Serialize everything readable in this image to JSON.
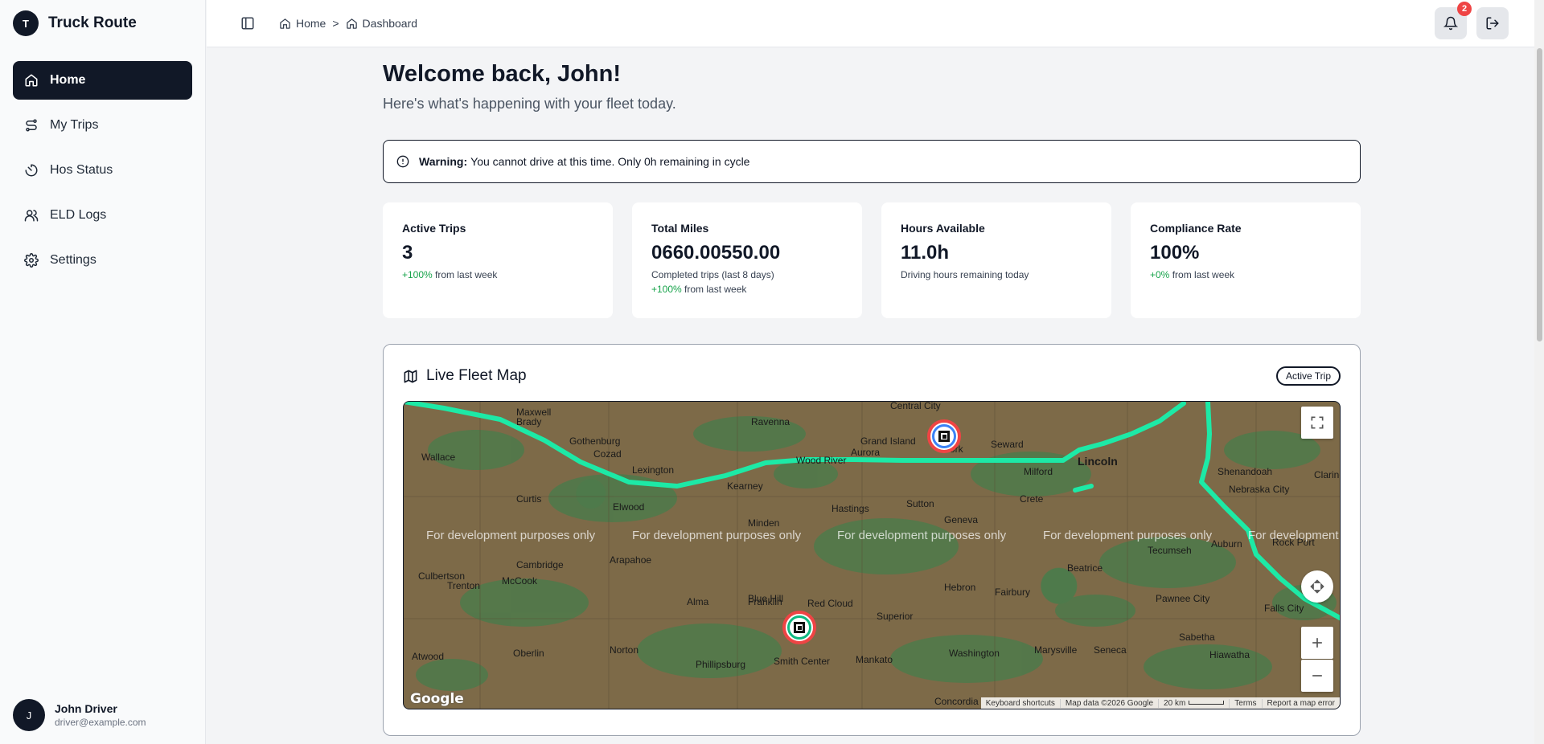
{
  "app": {
    "logo_letter": "T",
    "name": "Truck Route"
  },
  "sidebar": {
    "items": [
      {
        "label": "Home",
        "icon": "home-icon",
        "active": true
      },
      {
        "label": "My Trips",
        "icon": "route-icon",
        "active": false
      },
      {
        "label": "Hos Status",
        "icon": "timer-icon",
        "active": false
      },
      {
        "label": "ELD Logs",
        "icon": "users-icon",
        "active": false
      },
      {
        "label": "Settings",
        "icon": "gear-icon",
        "active": false
      }
    ]
  },
  "user": {
    "initial": "J",
    "name": "John Driver",
    "email": "driver@example.com"
  },
  "header": {
    "breadcrumb": [
      {
        "label": "Home",
        "separator": ">"
      },
      {
        "label": "Dashboard"
      }
    ],
    "notification_count": "2"
  },
  "page": {
    "title": "Welcome back, John!",
    "subtitle": "Here's what's happening with your fleet today."
  },
  "alert": {
    "label": "Warning:",
    "message": "You cannot drive at this time. Only 0h remaining in cycle"
  },
  "stats": [
    {
      "label": "Active Trips",
      "value": "3",
      "change": "+100%",
      "change_suffix": "from last week"
    },
    {
      "label": "Total Miles",
      "value": "0660.00550.00",
      "note": "Completed trips (last 8 days)",
      "change": "+100%",
      "change_suffix": "from last week"
    },
    {
      "label": "Hours Available",
      "value": "11.0h",
      "note": "Driving hours remaining today"
    },
    {
      "label": "Compliance Rate",
      "value": "100%",
      "change": "+0%",
      "change_suffix": "from last week"
    }
  ],
  "map_panel": {
    "title": "Live Fleet Map",
    "status": "Active Trip",
    "watermark": "For development purposes only",
    "cities": [
      "Central City",
      "Maxwell",
      "Brady",
      "Ravenna",
      "Grand Island",
      "Aurora",
      "Seward",
      "Lincoln",
      "Gothenburg",
      "Cozad",
      "Wallace",
      "Lexington",
      "Wood River",
      "York",
      "Milford",
      "Kearney",
      "Shenandoah",
      "Nebraska City",
      "Curtis",
      "Elwood",
      "Hastings",
      "Sutton",
      "Crete",
      "Minden",
      "Geneva",
      "Cambridge",
      "Arapahoe",
      "Beatrice",
      "Tecumseh",
      "Auburn",
      "Culbertson",
      "Trenton",
      "McCook",
      "Blue Hill",
      "Hebron",
      "Fairbury",
      "Alma",
      "Franklin",
      "Red Cloud",
      "Pawnee City",
      "Falls City",
      "Superior",
      "Rock Port",
      "Atwood",
      "Oberlin",
      "Norton",
      "Phillipsburg",
      "Smith Center",
      "Mankato",
      "Washington",
      "Marysville",
      "Seneca",
      "Sabetha",
      "Hiawatha",
      "Concordia",
      "Clarinda"
    ],
    "map_brand": "Google",
    "footer": [
      "Keyboard shortcuts",
      "Map data ©2026 Google",
      "20 km",
      "Terms",
      "Report a map error"
    ],
    "colors": {
      "route": "#1de9a6",
      "marker_ring": "#ef4444",
      "land": "#7d6a48",
      "vegetation": "#4e7a4b"
    }
  }
}
